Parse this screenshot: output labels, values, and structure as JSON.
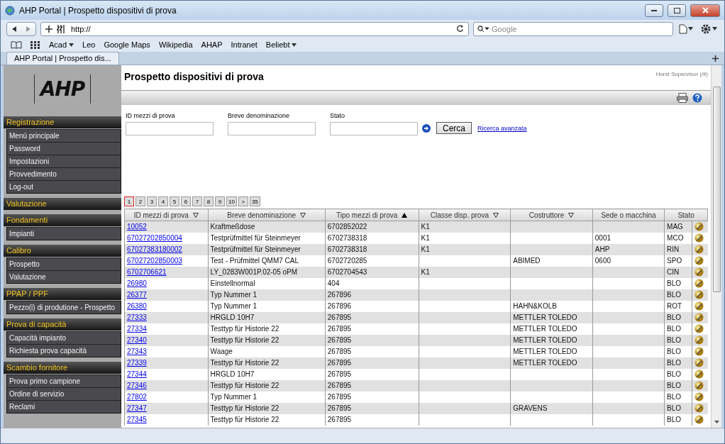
{
  "window": {
    "title": "AHP Portal | Prospetto dispositivi di prova"
  },
  "browser": {
    "address": "http://",
    "search_placeholder": "Google",
    "bookmarks": [
      {
        "label": "Acad",
        "has_menu": true
      },
      {
        "label": "Leo",
        "has_menu": false
      },
      {
        "label": "Google Maps",
        "has_menu": false
      },
      {
        "label": "Wikipedia",
        "has_menu": false
      },
      {
        "label": "AHAP",
        "has_menu": false
      },
      {
        "label": "Intranet",
        "has_menu": false
      },
      {
        "label": "Beliebt",
        "has_menu": true
      }
    ],
    "tabs": [
      {
        "label": "AHP Portal | Prospetto dis...",
        "selected": true
      }
    ]
  },
  "sidebar": {
    "logo": "AHP",
    "sections": [
      {
        "title": "Registrazione",
        "items": [
          "Menù principale",
          "Password",
          "Impostazioni",
          "Provvedimento",
          "Log-out"
        ]
      },
      {
        "title": "Valutazione"
      },
      {
        "title": "Fondamenti",
        "items": [
          "Impianti"
        ]
      },
      {
        "title": "Calibro",
        "items": [
          "Prospetto",
          "Valutazione"
        ]
      },
      {
        "title": "PPAP / PPF",
        "items": [
          "Pezzo(i) di produtione - Prospetto"
        ]
      },
      {
        "title": "Prova di capacità",
        "items": [
          "Capacità impianto",
          "Richiesta prova capacità"
        ]
      },
      {
        "title": "Scambio fornitore",
        "items": [
          "Prova primo campione",
          "Ordine di servizio",
          "Reclami"
        ]
      }
    ]
  },
  "page": {
    "title": "Prospetto dispositivi di prova",
    "user": "Horst Supervisor (/it)"
  },
  "filters": [
    {
      "label": "ID mezzi di prova"
    },
    {
      "label": "Breve denominazione"
    },
    {
      "label": "Stato"
    }
  ],
  "search_button": "Cerca",
  "advanced_search_link": "Ricerca avanzata",
  "pagination": [
    {
      "label": "1",
      "selected": true
    },
    {
      "label": "2",
      "selected": false
    },
    {
      "label": "3",
      "selected": false
    },
    {
      "label": "4",
      "selected": false
    },
    {
      "label": "5",
      "selected": false
    },
    {
      "label": "6",
      "selected": false
    },
    {
      "label": "7",
      "selected": false
    },
    {
      "label": "8",
      "selected": false
    },
    {
      "label": "9",
      "selected": false
    },
    {
      "label": "10",
      "selected": false
    },
    {
      "label": ">",
      "selected": false
    },
    {
      "label": "35",
      "selected": false
    }
  ],
  "table": {
    "columns": [
      {
        "label": "ID mezzi di prova",
        "sortable": true,
        "sorted": false
      },
      {
        "label": "Breve denominazione",
        "sortable": true,
        "sorted": false
      },
      {
        "label": "Tipo mezzi di prova",
        "sortable": true,
        "sorted": true
      },
      {
        "label": "Classe disp. prova",
        "sortable": true,
        "sorted": false
      },
      {
        "label": "Costruttore",
        "sortable": true,
        "sorted": false
      },
      {
        "label": "Sede o macchina",
        "sortable": false,
        "sorted": false
      },
      {
        "label": "Stato",
        "sortable": false,
        "sorted": false
      }
    ],
    "rows": [
      [
        "10052",
        "Kraftmeßdose",
        "6702852022",
        "K1",
        "",
        "",
        "MAG"
      ],
      [
        "67027202850004",
        "Testprüfmittel für Steinmeyer",
        "6702738318",
        "K1",
        "",
        "0001",
        "MCO"
      ],
      [
        "67027383180002",
        "Testprüfmittel für Steinmeyer",
        "6702738318",
        "K1",
        "",
        "AHP",
        "RIN"
      ],
      [
        "67027202850003",
        "Test - Prüfmittel QMM7 CAL",
        "6702720285",
        "",
        "ABIMED",
        "0600",
        "SPO"
      ],
      [
        "6702706621",
        "LY_0283W001P.02-05 oPM",
        "6702704543",
        "K1",
        "",
        "",
        "CIN"
      ],
      [
        "26980",
        "Einstellnormal",
        "404",
        "",
        "",
        "",
        "BLO"
      ],
      [
        "26377",
        "Typ Nummer 1",
        "267896",
        "",
        "",
        "",
        "BLO"
      ],
      [
        "26380",
        "Typ Nummer 1",
        "267896",
        "",
        "HAHN&KOLB",
        "",
        "ROT"
      ],
      [
        "27333",
        "HRGLD 10H7",
        "267895",
        "",
        "METTLER TOLEDO",
        "",
        "BLO"
      ],
      [
        "27334",
        "Testtyp für Historie 22",
        "267895",
        "",
        "METTLER TOLEDO",
        "",
        "BLO"
      ],
      [
        "27340",
        "Testtyp für Historie 22",
        "267895",
        "",
        "METTLER TOLEDO",
        "",
        "BLO"
      ],
      [
        "27343",
        "Waage",
        "267895",
        "",
        "METTLER TOLEDO",
        "",
        "BLO"
      ],
      [
        "27339",
        "Testtyp für Historie 22",
        "267895",
        "",
        "METTLER TOLEDO",
        "",
        "BLO"
      ],
      [
        "27344",
        "HRGLD 10H7",
        "267895",
        "",
        "",
        "",
        "BLO"
      ],
      [
        "27346",
        "Testtyp für Historie 22",
        "267895",
        "",
        "",
        "",
        "BLO"
      ],
      [
        "27802",
        "Typ Nummer 1",
        "267895",
        "",
        "",
        "",
        "BLO"
      ],
      [
        "27347",
        "Testtyp für Historie 22",
        "267895",
        "",
        "GRAVENS",
        "",
        "BLO"
      ],
      [
        "27345",
        "Testtyp für Historie 22",
        "267895",
        "",
        "",
        "",
        "BLO"
      ]
    ]
  }
}
